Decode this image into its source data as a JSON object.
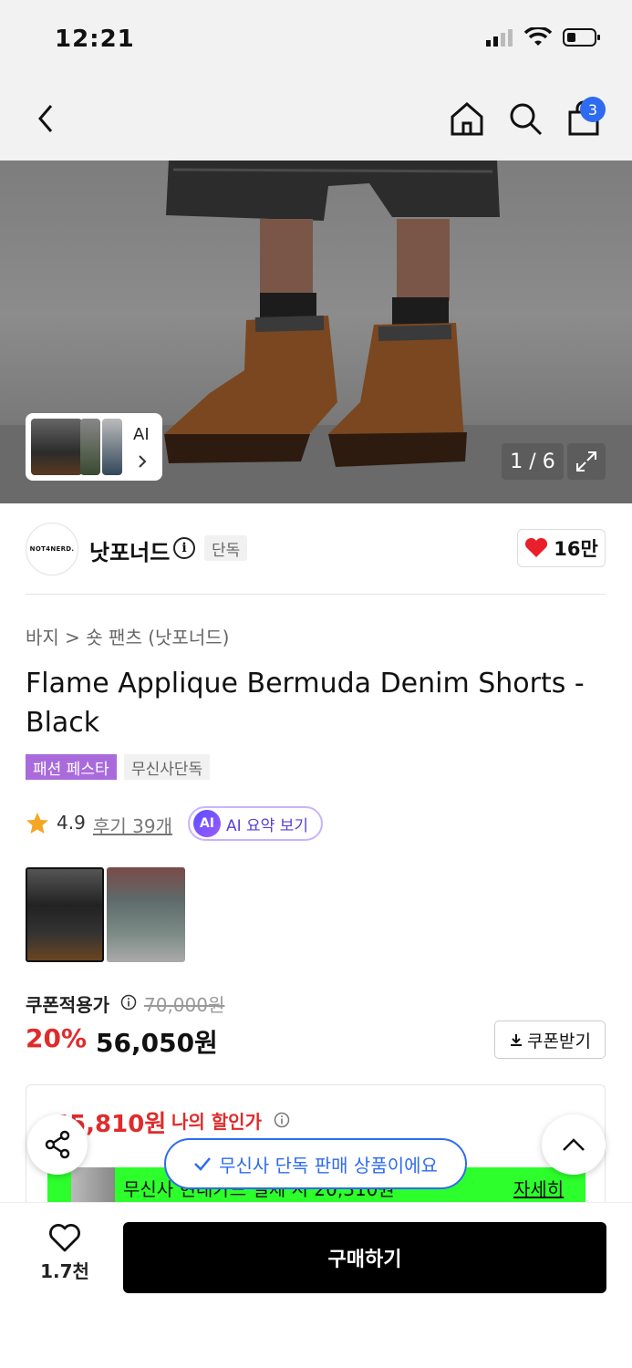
{
  "status_bar": {
    "time": "12:21"
  },
  "nav": {
    "cart_count": "3"
  },
  "hero": {
    "mini_label": "AI",
    "counter": "1 / 6"
  },
  "brand": {
    "logo_text": "NOT4NERD.",
    "name": "낫포너드",
    "tag": "단독",
    "likes": "16만"
  },
  "breadcrumb": {
    "category": "바지",
    "sub": "숏 팬츠 (낫포너드)"
  },
  "product": {
    "title": "Flame Applique Bermuda Denim Shorts - Black",
    "tags": [
      "패션 페스타",
      "무신사단독"
    ],
    "rating": "4.9",
    "reviews": "후기 39개",
    "ai_summary": "AI 요약 보기",
    "ai_badge": "AI"
  },
  "price": {
    "coupon_label": "쿠폰적용가",
    "original": "70,000원",
    "discount": "20%",
    "final": "56,050원",
    "coupon_button": "쿠폰받기"
  },
  "promo": {
    "my_price": "45,810원",
    "my_label": "나의 할인가",
    "green_text": "무신사 현대카드 결제 시 20,310원",
    "green_link": "자세히"
  },
  "toast": {
    "text": "무신사 단독 판매 상품이에요"
  },
  "bottom": {
    "like_count": "1.7천",
    "buy_label": "구매하기"
  },
  "colors": {
    "accent_blue": "#2f6bf0",
    "sale_red": "#e02b2b",
    "fest_purple": "#a96bdc",
    "promo_green": "#2cff2c"
  }
}
